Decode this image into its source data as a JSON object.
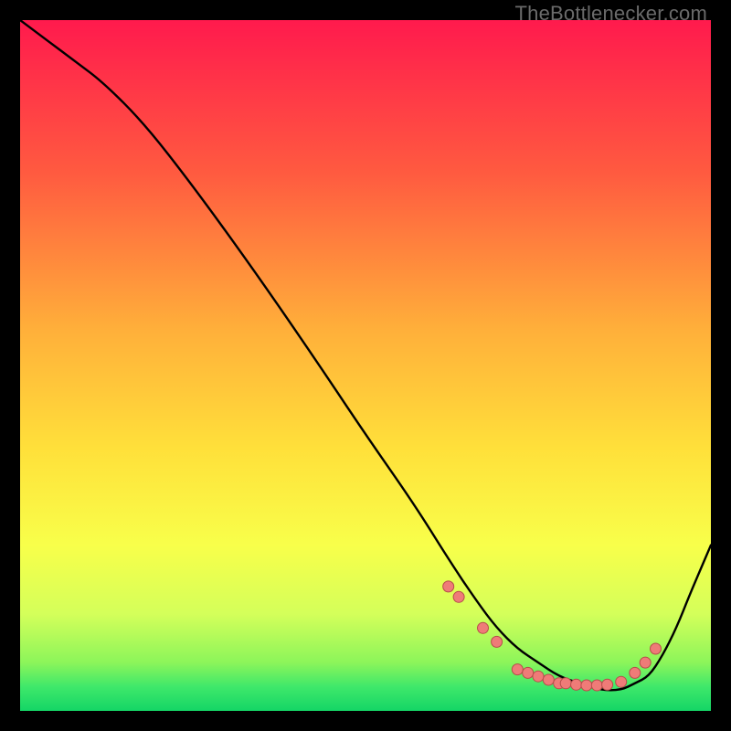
{
  "watermark": "TheBottlenecker.com",
  "colors": {
    "bg_black": "#000000",
    "curve": "#000000",
    "dot_fill": "#ef7b78",
    "dot_stroke": "#b64d4a",
    "grad_top": "#ff1a4d",
    "grad_mid1": "#ff7a3a",
    "grad_mid2": "#ffd23a",
    "grad_mid3": "#f8ff4a",
    "grad_mid4": "#d4ff66",
    "grad_bot": "#14e06e"
  },
  "chart_data": {
    "type": "line",
    "title": "",
    "xlabel": "",
    "ylabel": "",
    "xlim": [
      0,
      100
    ],
    "ylim": [
      0,
      100
    ],
    "curve": {
      "x": [
        0,
        4,
        8,
        12,
        18,
        25,
        33,
        42,
        50,
        57,
        62,
        66,
        69,
        72,
        75,
        78,
        81,
        84,
        87,
        89,
        91,
        93,
        95,
        97,
        100
      ],
      "y": [
        100,
        97,
        94,
        91,
        85,
        76,
        65,
        52,
        40,
        30,
        22,
        16,
        12,
        9,
        7,
        5,
        4,
        3,
        3,
        4,
        5,
        8,
        12,
        17,
        24
      ]
    },
    "dots": {
      "x": [
        62,
        63.5,
        67,
        69,
        72,
        73.5,
        75,
        76.5,
        78,
        79,
        80.5,
        82,
        83.5,
        85,
        87,
        89,
        90.5,
        92
      ],
      "y": [
        18,
        16.5,
        12,
        10,
        6,
        5.5,
        5,
        4.5,
        4,
        4,
        3.8,
        3.7,
        3.7,
        3.8,
        4.2,
        5.5,
        7,
        9
      ]
    }
  }
}
